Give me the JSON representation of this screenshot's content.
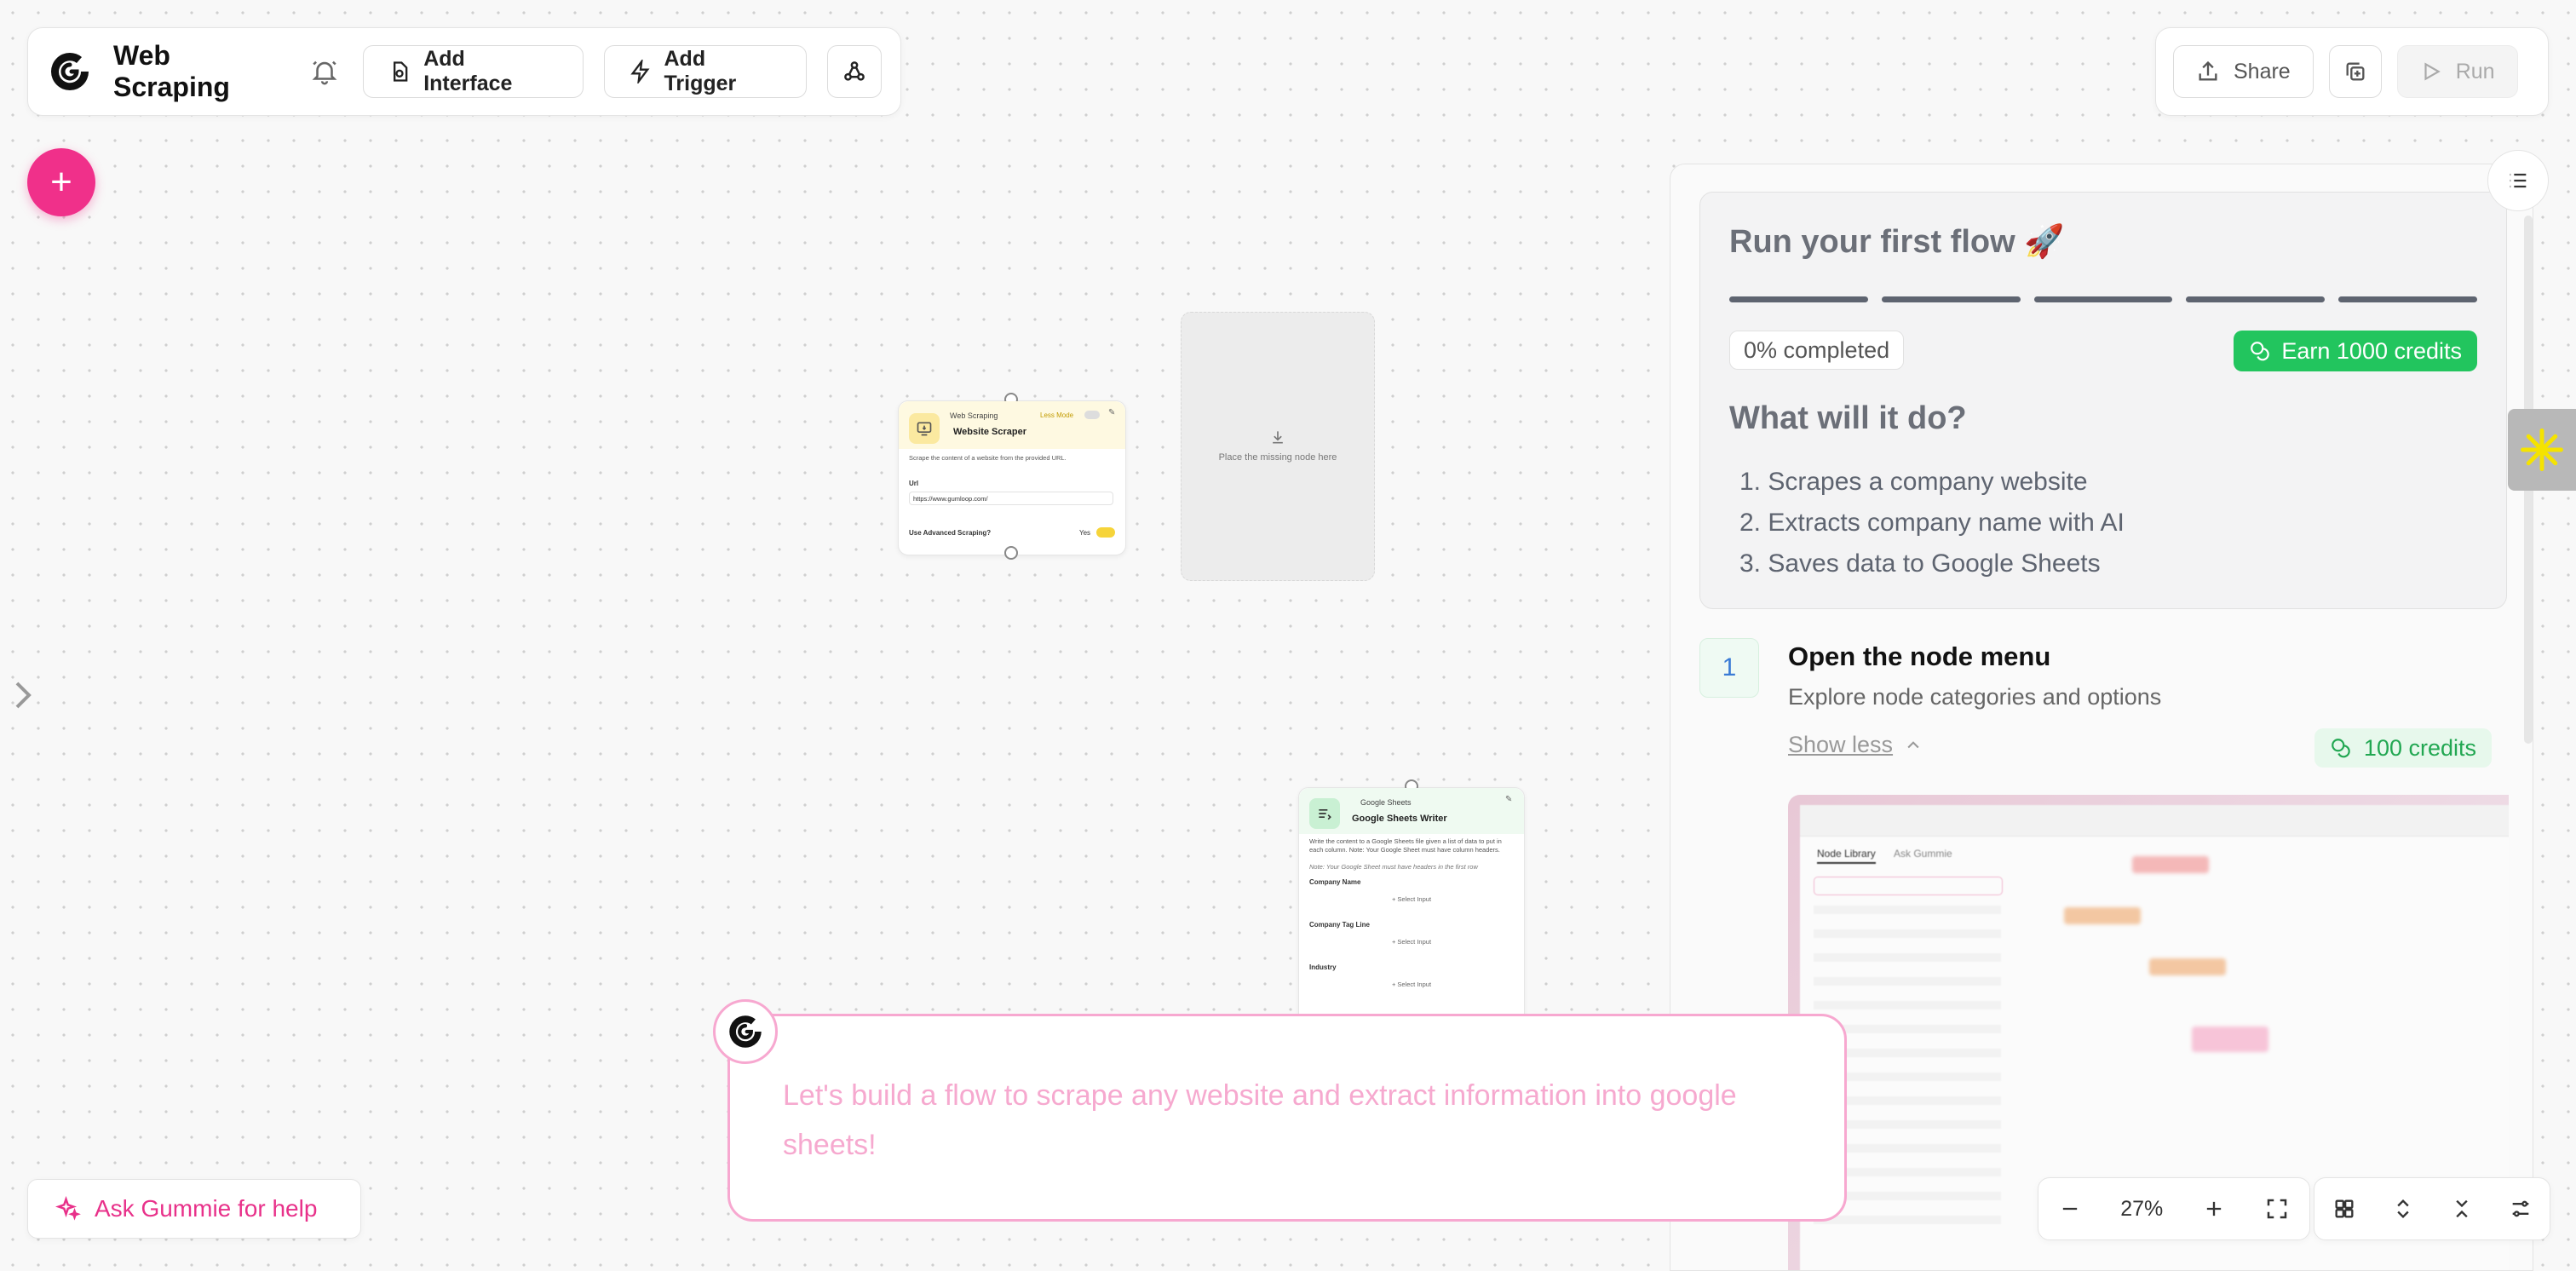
{
  "toolbar": {
    "title": "Web Scraping",
    "add_interface": "Add Interface",
    "add_trigger": "Add Trigger"
  },
  "top_right": {
    "share": "Share",
    "run": "Run"
  },
  "nodes": {
    "scraper": {
      "category": "Web Scraping",
      "mode": "Less Mode",
      "name": "Website Scraper",
      "description": "Scrape the content of a website from the provided URL.",
      "url_label": "Url",
      "url_value": "https://www.gumloop.com/",
      "advanced_label": "Use Advanced Scraping?",
      "advanced_value": "Yes"
    },
    "placeholder": {
      "text": "Place the missing node here"
    },
    "sheets": {
      "category": "Google Sheets",
      "name": "Google Sheets Writer",
      "description": "Write the content to a Google Sheets file given a list of data to put in each column. Note: Your Google Sheet must have column headers.",
      "note": "Note: Your Google Sheet must have headers in the first row",
      "fields": [
        {
          "label": "Company Name",
          "input": "+ Select Input"
        },
        {
          "label": "Company Tag Line",
          "input": "+ Select Input"
        },
        {
          "label": "Industry",
          "input": "+ Select Input"
        }
      ]
    }
  },
  "guide": {
    "title": "Run your first flow 🚀",
    "progress_percent": 0,
    "progress_text": "0% completed",
    "earn_badge": "Earn 1000 credits",
    "what_title": "What will it do?",
    "steps": [
      "1. Scrapes a company website",
      "2. Extracts company name with AI",
      "3. Saves data to Google Sheets"
    ],
    "step_number": "1",
    "step_title": "Open the node menu",
    "step_desc": "Explore node categories and options",
    "show_less": "Show less",
    "credits_badge": "100 credits"
  },
  "preview": {
    "tab_active": "Node Library",
    "tab_other": "Ask Gummie"
  },
  "chat": {
    "message": "Let's build a flow to scrape any website and extract information into google sheets!"
  },
  "help": {
    "label": "Ask Gummie for help"
  },
  "zoom": {
    "level": "27%"
  },
  "colors": {
    "accent_pink": "#f0308a",
    "green": "#22c55e",
    "chat_text": "#f6a9cf"
  }
}
